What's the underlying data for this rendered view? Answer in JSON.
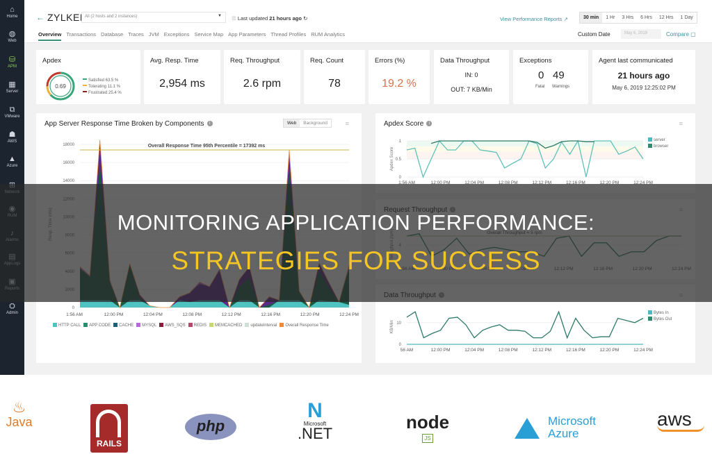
{
  "sidebar": {
    "items": [
      {
        "label": "Home",
        "icon": "home-icon",
        "glyph": "⌂"
      },
      {
        "label": "Web",
        "icon": "globe-icon",
        "glyph": "◍"
      },
      {
        "label": "APM",
        "icon": "apm-icon",
        "glyph": "⛁"
      },
      {
        "label": "Server",
        "icon": "server-icon",
        "glyph": "▦"
      },
      {
        "label": "VMware",
        "icon": "vmware-icon",
        "glyph": "⧉"
      },
      {
        "label": "AWS",
        "icon": "aws-icon",
        "glyph": "☗"
      },
      {
        "label": "Azure",
        "icon": "azure-icon",
        "glyph": "▲"
      },
      {
        "label": "Network",
        "icon": "network-icon",
        "glyph": "⊞"
      },
      {
        "label": "RUM",
        "icon": "rum-icon",
        "glyph": "◉"
      },
      {
        "label": "Alarms",
        "icon": "bell-icon",
        "glyph": "♪"
      },
      {
        "label": "AppLogs",
        "icon": "logs-icon",
        "glyph": "▤"
      },
      {
        "label": "Reports",
        "icon": "reports-icon",
        "glyph": "▣"
      },
      {
        "label": "Admin",
        "icon": "admin-icon",
        "glyph": "⛭"
      }
    ]
  },
  "header": {
    "back_glyph": "←",
    "app_name": "ZYLKER",
    "host_select": "All (2 hosts and 2 instances)",
    "last_updated_label": "Last updated",
    "last_updated_value": "21 hours ago",
    "refresh_glyph": "↻",
    "perf_reports_link": "View Performance Reports ↗",
    "time_ranges": [
      "30 min",
      "1 Hr",
      "3 Hrs",
      "6 Hrs",
      "12 Hrs",
      "1 Day"
    ],
    "active_range": "30 min",
    "custom_date_label": "Custom Date",
    "custom_date_value": "May 6, 2019",
    "compare_label": "Compare ▢"
  },
  "tabs": [
    "Overview",
    "Transactions",
    "Database",
    "Traces",
    "JVM",
    "Exceptions",
    "Service Map",
    "App Parameters",
    "Thread Profiles",
    "RUM Analytics"
  ],
  "summary": {
    "apdex": {
      "title": "Apdex",
      "score": "0.69",
      "satisfied": "Satisfied 63.5 %",
      "tolerating": "Tolerating 11.1 %",
      "frustrated": "Frustrated 25.4 %",
      "satisfied_pct": 63.5,
      "tolerating_pct": 11.1,
      "frustrated_pct": 25.4
    },
    "avg_resp": {
      "title": "Avg. Resp. Time",
      "value": "2,954 ms"
    },
    "throughput": {
      "title": "Req. Throughput",
      "value": "2.6 rpm"
    },
    "count": {
      "title": "Req. Count",
      "value": "78"
    },
    "errors": {
      "title": "Errors (%)",
      "value": "19.2 %"
    },
    "data_throughput": {
      "title": "Data Throughput",
      "in": "IN: 0",
      "out": "OUT: 7 KB/Min"
    },
    "exceptions": {
      "title": "Exceptions",
      "fatal": "0",
      "fatal_label": "Fatal",
      "warnings": "49",
      "warnings_label": "Warnings"
    },
    "agent": {
      "title": "Agent last communicated",
      "ago": "21 hours ago",
      "time": "May 6, 2019 12:25:02 PM"
    }
  },
  "colors": {
    "accent": "#3a8f78",
    "error": "#d9704a",
    "satisfied": "#3aa57a",
    "tolerating": "#f0b040",
    "frustrated": "#c0392b"
  },
  "chart_data": [
    {
      "type": "area",
      "title": "App Server Response Time Broken by Components",
      "toggle": [
        "Web",
        "Background"
      ],
      "active_toggle": "Web",
      "ylabel": "Resp. Time (ms)",
      "xlabel": "",
      "ylim": [
        0,
        18000
      ],
      "yticks": [
        0,
        2000,
        4000,
        6000,
        8000,
        10000,
        12000,
        14000,
        16000,
        18000
      ],
      "xticks": [
        "1:56 AM",
        "12:00 PM",
        "12:04 PM",
        "12:08 PM",
        "12:12 PM",
        "12:16 PM",
        "12:20 PM",
        "12:24 PM"
      ],
      "annotation": "Overall Response Time 95th Percentile = 17392 ms",
      "threshold": 17392,
      "legend": [
        "HTTP CALL",
        "APP CODE",
        "CACHE",
        "MYSQL",
        "AWS_SQS",
        "REDIS",
        "MEMCACHED",
        "updateInterval",
        "Overall Response Time"
      ],
      "legend_colors": [
        "#4fc3c0",
        "#2e8b6e",
        "#1d5f7a",
        "#b868d8",
        "#8a1d3a",
        "#b04a6a",
        "#c8d870",
        "#d0dfd8",
        "#f08a3a"
      ],
      "series": [
        {
          "name": "HTTP CALL",
          "values": [
            800,
            800,
            800,
            800,
            0,
            800,
            800,
            200,
            0,
            0,
            800,
            600,
            800,
            800,
            800,
            0,
            800,
            800,
            0,
            0,
            800,
            800,
            800,
            0,
            800,
            700,
            600,
            300
          ]
        },
        {
          "name": "APP CODE",
          "values": [
            3500,
            2600,
            15000,
            2000,
            0,
            4000,
            300,
            0,
            0,
            0,
            0,
            0,
            0,
            0,
            0,
            0,
            1500,
            2500,
            0,
            300,
            0,
            14500,
            1000,
            0,
            3300,
            1500,
            0,
            4000
          ]
        },
        {
          "name": "MYSQL",
          "values": [
            0,
            0,
            2500,
            0,
            0,
            0,
            300,
            0,
            0,
            0,
            300,
            1000,
            1800,
            1500,
            3300,
            0,
            800,
            1200,
            0,
            800,
            0,
            1500,
            0,
            0,
            800,
            500,
            0,
            0
          ]
        },
        {
          "name": "Overall Response Time",
          "values": [
            4500,
            3500,
            18500,
            3000,
            0,
            4800,
            1000,
            200,
            0,
            0,
            1200,
            1500,
            2800,
            2200,
            4200,
            0,
            3000,
            4500,
            0,
            1200,
            0,
            17400,
            1800,
            0,
            4800,
            2600,
            600,
            4600
          ]
        }
      ]
    },
    {
      "type": "line",
      "title": "Apdex Score",
      "ylabel": "Apdex Score",
      "ylim": [
        0,
        1
      ],
      "yticks": [
        "0",
        "0.5",
        "1"
      ],
      "xticks": [
        "1:56 AM",
        "12:00 PM",
        "12:04 PM",
        "12:08 PM",
        "12:12 PM",
        "12:16 PM",
        "12:20 PM",
        "12:24 PM"
      ],
      "legend": [
        "server",
        "browser"
      ],
      "legend_colors": [
        "#4fb8c0",
        "#2e8b6e"
      ],
      "series": [
        {
          "name": "server",
          "values": [
            0.75,
            0.8,
            0.0,
            0.5,
            1.0,
            0.75,
            0.75,
            1.0,
            1.0,
            0.75,
            0.72,
            0.68,
            0.25,
            0.38,
            0.5,
            1.0,
            0.92,
            0.25,
            0.5,
            0.97,
            0.63,
            1.0,
            0.0,
            1.0,
            1.0,
            1.0,
            0.63,
            0.72,
            0.83,
            0.5
          ]
        },
        {
          "name": "browser",
          "values": [
            null,
            null,
            null,
            0.93,
            1.0,
            1.0,
            1.0,
            1.0,
            1.0,
            1.0,
            1.0,
            1.0,
            1.0,
            1.0,
            1.0,
            1.0,
            0.96,
            0.8,
            0.87,
            0.98,
            1.0,
            1.0,
            0.98,
            0.98,
            null,
            null,
            null,
            null,
            null,
            null
          ]
        }
      ]
    },
    {
      "type": "line",
      "title": "Request Throughput",
      "ylabel": "Throughput (rpm)",
      "annotation": "Overall Throughput = 5 rpm",
      "ylim": [
        0,
        8
      ],
      "yticks": [
        "4"
      ],
      "xticks": [
        "1:56 AM",
        "12:00 PM",
        "12:04 PM",
        "12:08 PM",
        "12:12 PM",
        "12:16 PM",
        "12:20 PM",
        "12:24 PM"
      ],
      "series": [
        {
          "name": "Throughput",
          "values": [
            6,
            6.5,
            1.5,
            3,
            5.5,
            2,
            3,
            3.5,
            3,
            2.5,
            2.5,
            1.5,
            5.5,
            6,
            1.5,
            4.5,
            4.5,
            1.5,
            2.5,
            2.5,
            5,
            6,
            6
          ]
        }
      ]
    },
    {
      "type": "line",
      "title": "Data Throughput",
      "ylabel": "KB/Min",
      "ylim": [
        0,
        16
      ],
      "yticks": [
        "0",
        "10"
      ],
      "xticks": [
        "56 AM",
        "12:00 PM",
        "12:04 PM",
        "12:08 PM",
        "12:12 PM",
        "12:16 PM",
        "12:20 PM",
        "12:24 PM"
      ],
      "legend": [
        "Bytes In",
        "Bytes Out"
      ],
      "legend_colors": [
        "#4fb8c0",
        "#2e8b6e"
      ],
      "series": [
        {
          "name": "Bytes In",
          "values": [
            0,
            0,
            0,
            0,
            0,
            0,
            0,
            0,
            0,
            0,
            0,
            0,
            0,
            0,
            0,
            0,
            0,
            0,
            0,
            0,
            0,
            0,
            0,
            0,
            0,
            0,
            0,
            0
          ]
        },
        {
          "name": "Bytes Out",
          "values": [
            12.5,
            15,
            3,
            5,
            6.5,
            12,
            12.5,
            9,
            3,
            6.5,
            8,
            9,
            6.5,
            6.5,
            6,
            3,
            3,
            6,
            15,
            3,
            12,
            6.5,
            3,
            3.5,
            3.5,
            12,
            11,
            10,
            12
          ]
        }
      ]
    }
  ],
  "overlay": {
    "line1": "MONITORING APPLICATION PERFORMANCE:",
    "line2": "STRATEGIES FOR SUCCESS"
  },
  "logos": [
    {
      "name": "Java",
      "text": "Java"
    },
    {
      "name": "Rails",
      "text": "RAILS"
    },
    {
      "name": "PHP",
      "text": "php"
    },
    {
      "name": "Microsoft .NET",
      "text_top": "Microsoft",
      "text_bottom": ".NET"
    },
    {
      "name": "Node.js",
      "text": "node",
      "sub": "JS"
    },
    {
      "name": "Microsoft Azure",
      "text_top": "Microsoft",
      "text_bottom": "Azure"
    },
    {
      "name": "AWS",
      "text": "aws"
    }
  ]
}
